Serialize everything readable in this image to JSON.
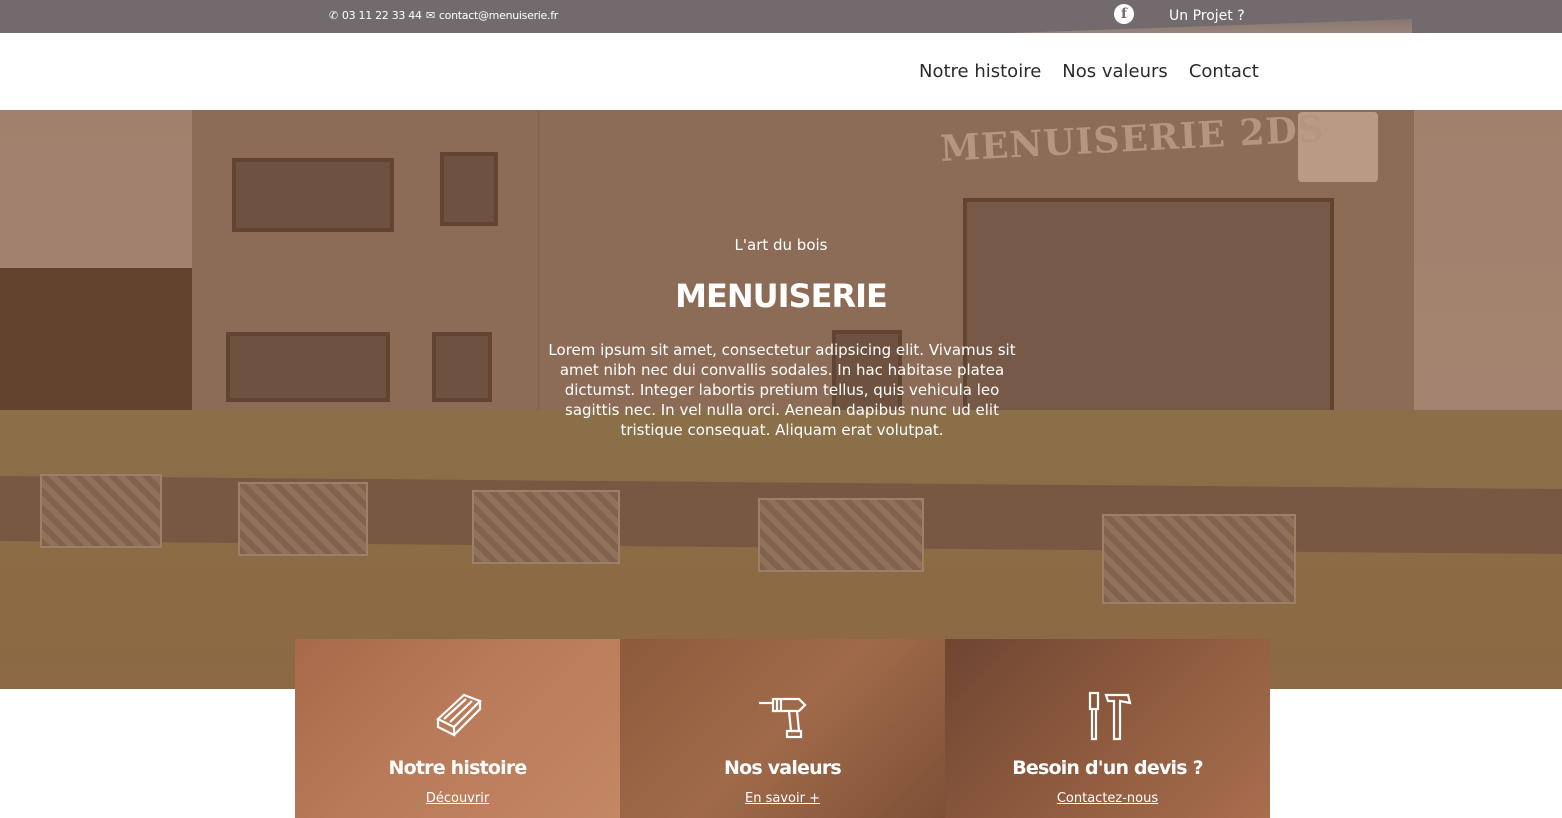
{
  "topbar": {
    "phone": "03 11 22 33 44",
    "email": "contact@menuiserie.fr",
    "facebook_icon": "facebook-icon",
    "cta": "Un Projet ?"
  },
  "nav": {
    "items": [
      {
        "label": "Notre histoire"
      },
      {
        "label": "Nos valeurs"
      },
      {
        "label": "Contact"
      }
    ]
  },
  "hero": {
    "tagline": "L'art du bois",
    "title": "MENUISERIE",
    "description": "Lorem ipsum sit amet, consectetur adipsicing elit. Vivamus sit amet nibh nec dui convallis sodales. In hac habitase platea dictumst. Integer labortis pretium tellus, quis vehicula leo sagittis nec. In vel nulla orci. Aenean dapibus nunc ud elit tristique consequat. Aliquam erat volutpat.",
    "photo_sign": "MENUISERIE 2DS"
  },
  "cards": [
    {
      "title": "Notre histoire",
      "link": "Découvrir",
      "icon": "wood-planks-icon"
    },
    {
      "title": "Nos valeurs",
      "link": "En savoir +",
      "icon": "drill-icon"
    },
    {
      "title": "Besoin d'un devis ?",
      "link": "Contactez-nous",
      "icon": "tools-icon"
    }
  ],
  "colors": {
    "topbar": "#736a6e",
    "overlay": "#8c5232",
    "card_tint": "#9b5a36"
  }
}
